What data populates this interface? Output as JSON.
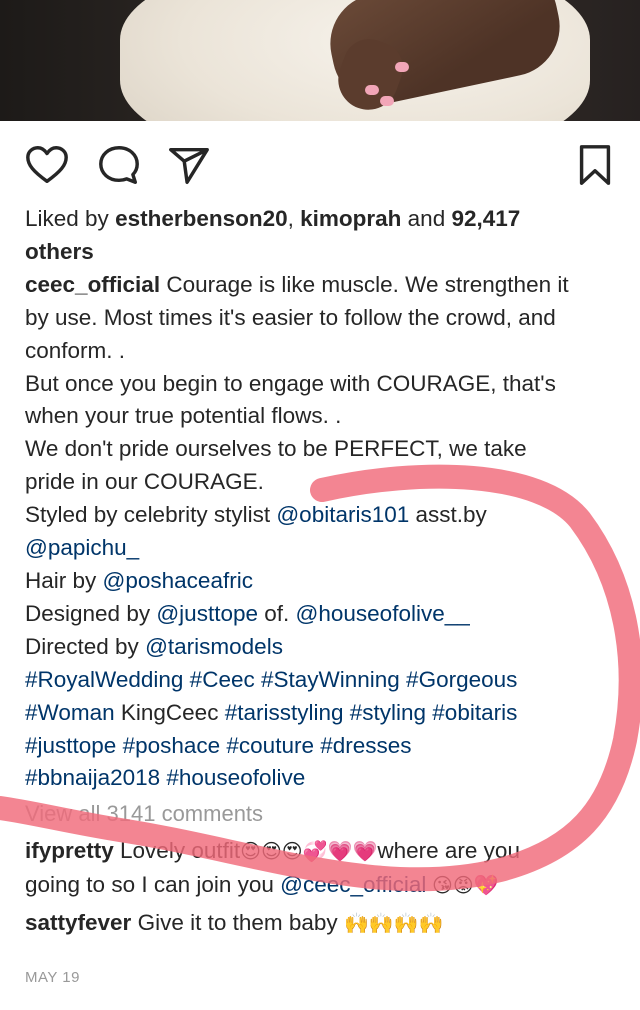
{
  "post": {
    "likes": {
      "prefix": "Liked by ",
      "user1": "estherbenson20",
      "sep": ", ",
      "user2": "kimoprah",
      "and": " and ",
      "count": "92,417",
      "others": "others"
    },
    "caption": {
      "username": "ceec_official",
      "l1": " Courage is like muscle. We strengthen it",
      "l2": "by use. Most times it's easier to follow the crowd, and",
      "l3": "conform. .",
      "l4": "But once you begin to engage with COURAGE, that's",
      "l5": "when your true potential flows. .",
      "l6": "We don't pride ourselves to be PERFECT, we take",
      "l7": "pride in our COURAGE.",
      "styled_prefix": "Styled by celebrity stylist ",
      "styled_handle": "@obitaris101",
      "styled_asst": " asst.by",
      "asst_handle": "@papichu_",
      "hair_prefix": "Hair by ",
      "hair_handle": "@poshaceafric",
      "designed_prefix": "Designed by ",
      "designed_handle": "@justtope",
      "designed_of": " of. ",
      "designed_handle2": "@houseofolive__",
      "directed_prefix": "Directed by ",
      "directed_handle": "@tarismodels",
      "tags_l1": "#RoyalWedding #Ceec #StayWinning #Gorgeous",
      "tags_l2_a": "#Woman",
      "tags_l2_b": " KingCeec ",
      "tags_l2_c": "#tarisstyling #styling #obitaris",
      "tags_l3": "#justtope #poshace #couture #dresses",
      "tags_l4": "#bbnaija2018 #houseofolive"
    },
    "view_all": "View all 3141 comments",
    "comments": [
      {
        "username": "ifypretty",
        "text1": " Lovely outfit",
        "emoji1": "😍😍😍💞💗💗",
        "text2": "where are you",
        "text3": "going to so I can join you ",
        "mention": "@ceec_official",
        "emoji2": " 😘😡💖"
      },
      {
        "username": "sattyfever",
        "text1": " Give it to them baby ",
        "emoji1": "🙌🙌🙌🙌"
      }
    ],
    "date": "MAY 19"
  },
  "icons": {
    "like": "heart-icon",
    "comment": "comment-bubble-icon",
    "share": "send-icon",
    "save": "bookmark-icon"
  },
  "colors": {
    "text": "#262626",
    "link": "#003569",
    "muted": "#999999",
    "marker": "#f06a7a"
  }
}
